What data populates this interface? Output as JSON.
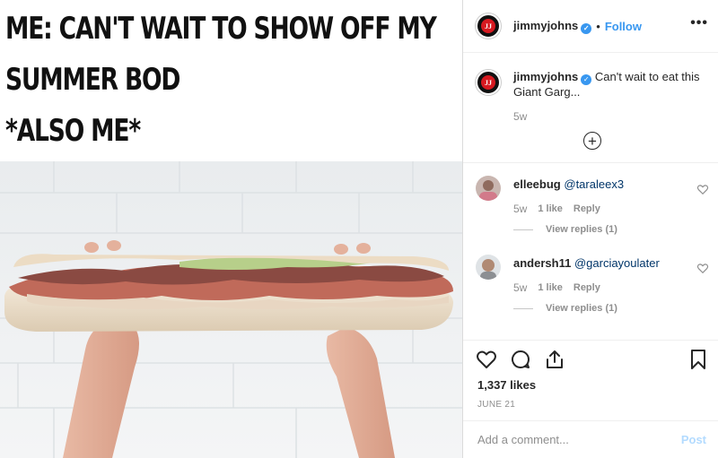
{
  "post": {
    "meme_lines": [
      "ME: CAN'T WAIT TO SHOW OFF MY",
      "SUMMER BOD",
      "*ALSO ME*"
    ]
  },
  "header": {
    "username": "jimmyjohns",
    "separator": "•",
    "follow_label": "Follow",
    "more_label": "•••",
    "avatar_text": "JJ"
  },
  "caption": {
    "username": "jimmyjohns",
    "text": "Can't wait to eat this Giant Garg...",
    "time": "5w"
  },
  "comments": [
    {
      "username": "elleebug",
      "mention": "@taraleex3",
      "time": "5w",
      "likes": "1 like",
      "reply_label": "Reply",
      "view_replies": "View replies (1)"
    },
    {
      "username": "andersh11",
      "mention": "@garciayoulater",
      "time": "5w",
      "likes": "1 like",
      "reply_label": "Reply",
      "view_replies": "View replies (1)"
    }
  ],
  "stats": {
    "likes": "1,337 likes",
    "date": "JUNE 21"
  },
  "comment_box": {
    "placeholder": "Add a comment...",
    "post_label": "Post"
  },
  "colors": {
    "accent": "#3897f0",
    "post_disabled": "#b3dbff",
    "brand_red": "#d71920"
  },
  "icons": [
    "heart-icon",
    "comment-icon",
    "share-icon",
    "bookmark-icon",
    "add-circle-icon",
    "verified-icon",
    "small-heart-icon"
  ]
}
